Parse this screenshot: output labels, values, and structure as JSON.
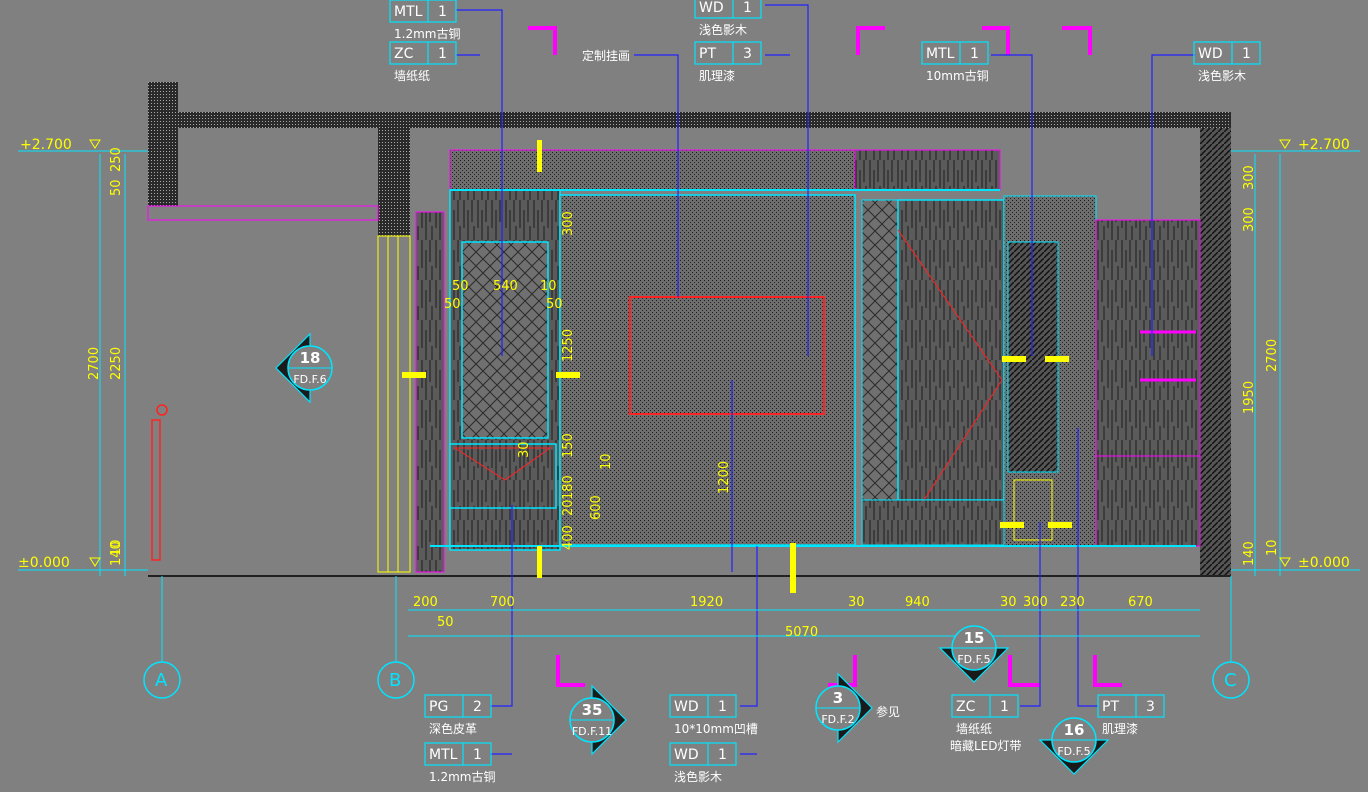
{
  "levels": {
    "top": "+2.700",
    "top_right": "+2.700",
    "bottom": "±0.000",
    "bottom_right": "±0.000"
  },
  "grid": {
    "a": "A",
    "b": "B",
    "c": "C"
  },
  "material_tags": [
    {
      "code": "MTL",
      "num": "1",
      "label": "1.2mm古铜"
    },
    {
      "code": "ZC",
      "num": "1",
      "label": "墙纸纸"
    },
    {
      "code": "WD",
      "num": "1",
      "label": "浅色影木"
    },
    {
      "code": "PT",
      "num": "3",
      "label": "肌理漆"
    },
    {
      "code": "MTL",
      "num": "1",
      "label": "10mm古铜"
    },
    {
      "code": "WD",
      "num": "1",
      "label": "浅色影木"
    },
    {
      "code": "PG",
      "num": "2",
      "label": "深色皮革"
    },
    {
      "code": "MTL",
      "num": "1",
      "label": "1.2mm古铜"
    },
    {
      "code": "WD",
      "num": "1",
      "label": "10*10mm凹槽"
    },
    {
      "code": "WD",
      "num": "1",
      "label": "浅色影木"
    },
    {
      "code": "ZC",
      "num": "1",
      "label": "墙纸纸"
    },
    {
      "code": "PT",
      "num": "3",
      "label": "肌理漆"
    }
  ],
  "extra_labels": {
    "painting": "定制挂画",
    "led": "暗藏LED灯带",
    "ref": "参见"
  },
  "sections": [
    {
      "num": "18",
      "ref": "FD.F.6"
    },
    {
      "num": "35",
      "ref": "FD.F.11"
    },
    {
      "num": "3",
      "ref": "FD.F.2"
    },
    {
      "num": "15",
      "ref": "FD.F.5"
    },
    {
      "num": "16",
      "ref": "FD.F.5"
    }
  ],
  "dims_bottom": [
    "200",
    "700",
    "1920",
    "30",
    "940",
    "30",
    "300",
    "230",
    "670"
  ],
  "dims_bottom2": [
    "50",
    "5070"
  ],
  "dims_left": [
    "50",
    "250",
    "2700",
    "2250",
    "10",
    "140"
  ],
  "dims_right": [
    "300",
    "300",
    "2700",
    "1950",
    "10",
    "140"
  ],
  "dims_inner": [
    "50",
    "540",
    "10",
    "50",
    "50",
    "300",
    "1250",
    "30",
    "150",
    "10",
    "180",
    "20",
    "600",
    "400",
    "1200"
  ]
}
